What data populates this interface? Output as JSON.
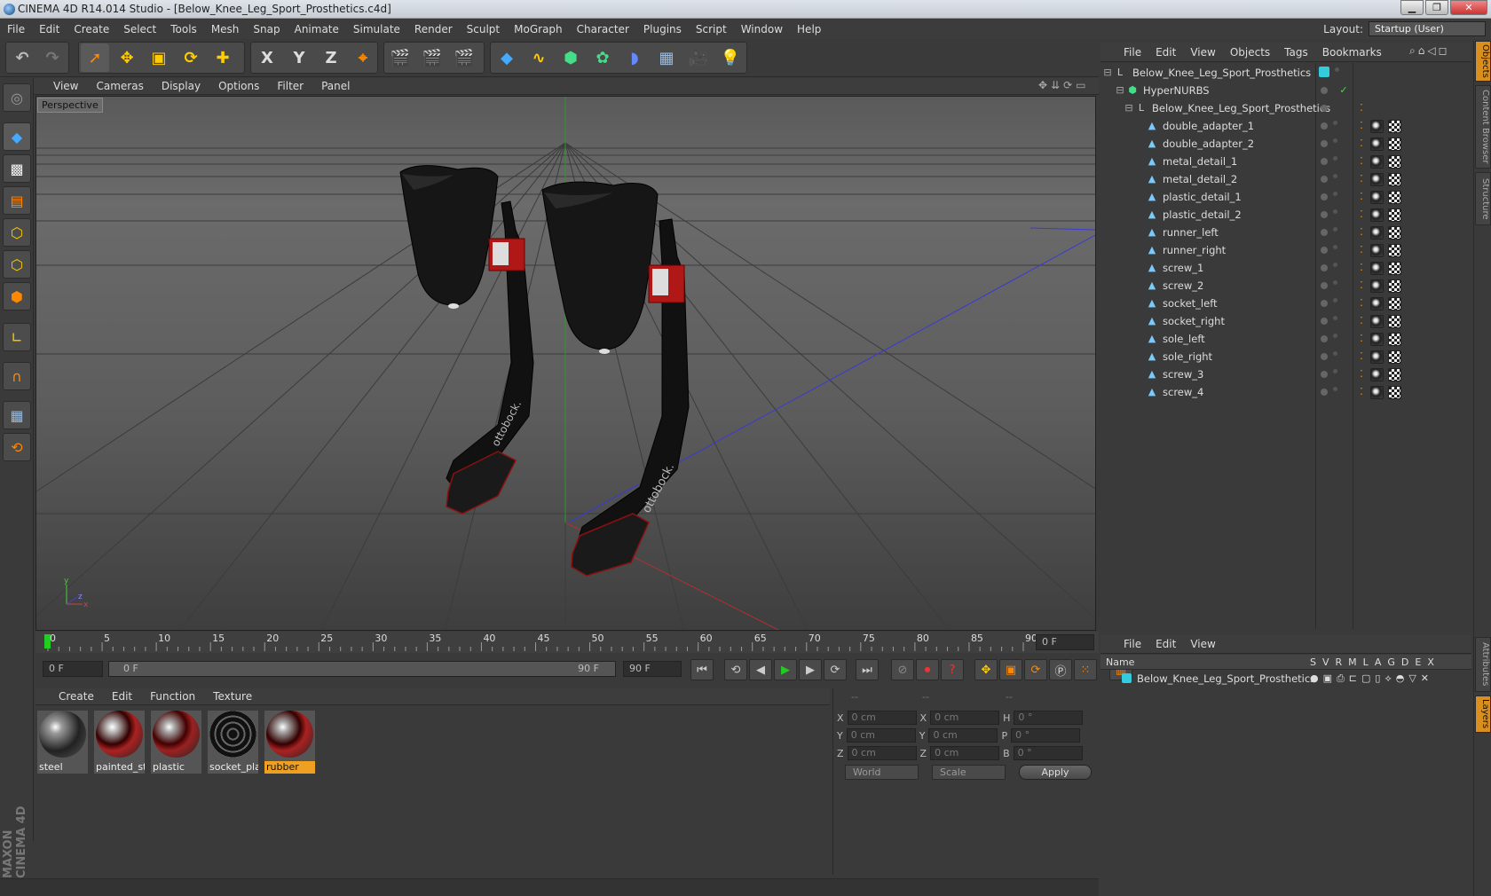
{
  "window": {
    "title": "CINEMA 4D R14.014 Studio - [Below_Knee_Leg_Sport_Prosthetics.c4d]"
  },
  "menu": [
    "File",
    "Edit",
    "Create",
    "Select",
    "Tools",
    "Mesh",
    "Snap",
    "Animate",
    "Simulate",
    "Render",
    "Sculpt",
    "MoGraph",
    "Character",
    "Plugins",
    "Script",
    "Window",
    "Help"
  ],
  "layout": {
    "label": "Layout:",
    "value": "Startup (User)"
  },
  "toolbar_axes": [
    "X",
    "Y",
    "Z"
  ],
  "viewport": {
    "menu": [
      "View",
      "Cameras",
      "Display",
      "Options",
      "Filter",
      "Panel"
    ],
    "label": "Perspective",
    "brand_text": "ottobock."
  },
  "timeline": {
    "ticks": [
      "0",
      "5",
      "10",
      "15",
      "20",
      "25",
      "30",
      "35",
      "40",
      "45",
      "50",
      "55",
      "60",
      "65",
      "70",
      "75",
      "80",
      "85",
      "90"
    ],
    "frame_box": "0 F",
    "start": "0 F",
    "range_start": "0 F",
    "range_end": "90 F",
    "end": "90 F"
  },
  "materials": {
    "menu": [
      "Create",
      "Edit",
      "Function",
      "Texture"
    ],
    "items": [
      {
        "name": "steel",
        "selected": false
      },
      {
        "name": "painted_st",
        "selected": false
      },
      {
        "name": "plastic",
        "selected": false
      },
      {
        "name": "socket_plas",
        "selected": false
      },
      {
        "name": "rubber",
        "selected": true
      }
    ]
  },
  "coords": {
    "headers": [
      "--",
      "--",
      "--"
    ],
    "rows": [
      {
        "a": "X",
        "av": "0 cm",
        "b": "X",
        "bv": "0 cm",
        "c": "H",
        "cv": "0 °"
      },
      {
        "a": "Y",
        "av": "0 cm",
        "b": "Y",
        "bv": "0 cm",
        "c": "P",
        "cv": "0 °"
      },
      {
        "a": "Z",
        "av": "0 cm",
        "b": "Z",
        "bv": "0 cm",
        "c": "B",
        "cv": "0 °"
      }
    ],
    "mode": "World",
    "mode2": "Scale",
    "apply": "Apply"
  },
  "objects": {
    "menu": [
      "File",
      "Edit",
      "View",
      "Objects",
      "Tags",
      "Bookmarks"
    ],
    "root": "Below_Knee_Leg_Sport_Prosthetics",
    "nurbs": "HyperNURBS",
    "group": "Below_Knee_Leg_Sport_Prosthetics",
    "children": [
      "double_adapter_1",
      "double_adapter_2",
      "metal_detail_1",
      "metal_detail_2",
      "plastic_detail_1",
      "plastic_detail_2",
      "runner_left",
      "runner_right",
      "screw_1",
      "screw_2",
      "socket_left",
      "socket_right",
      "sole_left",
      "sole_right",
      "screw_3",
      "screw_4"
    ]
  },
  "layers": {
    "menu": [
      "File",
      "Edit",
      "View"
    ],
    "header_name": "Name",
    "header_cols": [
      "S",
      "V",
      "R",
      "M",
      "L",
      "A",
      "G",
      "D",
      "E",
      "X"
    ],
    "row": "Below_Knee_Leg_Sport_Prosthetics"
  },
  "right_tabs": [
    "Objects",
    "Content Browser",
    "Structure",
    "Attributes",
    "Layers"
  ],
  "brand": "MAXON CINEMA 4D"
}
